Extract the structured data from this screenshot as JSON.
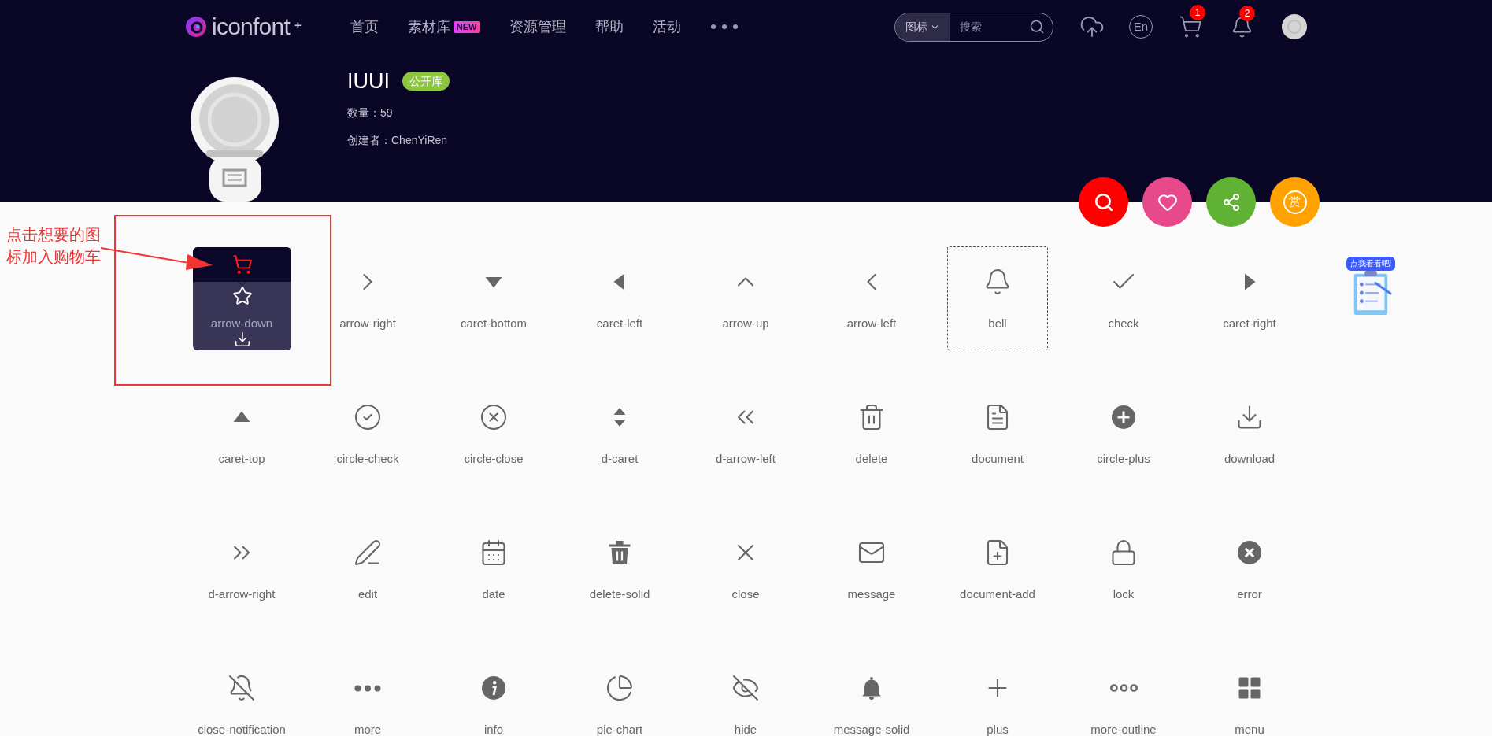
{
  "nav": {
    "logo": "iconfont",
    "logo_mark": "+",
    "items": [
      {
        "label": "首页"
      },
      {
        "label": "素材库",
        "badge": "NEW"
      },
      {
        "label": "资源管理"
      },
      {
        "label": "帮助"
      },
      {
        "label": "活动"
      }
    ]
  },
  "search": {
    "scope": "图标",
    "placeholder": "搜索"
  },
  "toolbar": {
    "language": "En",
    "cart_count": "1",
    "notification_count": "2"
  },
  "library": {
    "title": "IUUI",
    "tag": "公开库",
    "count": "数量：59",
    "creator": "创建者：ChenYiRen"
  },
  "actions": [
    {
      "kind": "search",
      "color": "#ff0000"
    },
    {
      "kind": "favorite",
      "color": "#e8498b"
    },
    {
      "kind": "share",
      "color": "#5fb233"
    },
    {
      "kind": "reward",
      "color": "#ffa200",
      "label": "赏"
    }
  ],
  "annotation": "点击想要的图标加入购物车",
  "promo": "点我看看吧!",
  "icons": [
    {
      "label": "arrow-down",
      "selected": false,
      "hovered": true
    },
    {
      "label": "arrow-right",
      "selected": false,
      "hovered": false
    },
    {
      "label": "caret-bottom",
      "selected": false,
      "hovered": false
    },
    {
      "label": "caret-left",
      "selected": false,
      "hovered": false
    },
    {
      "label": "arrow-up",
      "selected": false,
      "hovered": false
    },
    {
      "label": "arrow-left",
      "selected": false,
      "hovered": false
    },
    {
      "label": "bell",
      "selected": true,
      "hovered": false
    },
    {
      "label": "check",
      "selected": false,
      "hovered": false
    },
    {
      "label": "caret-right",
      "selected": false,
      "hovered": false
    },
    {
      "label": "caret-top",
      "selected": false,
      "hovered": false
    },
    {
      "label": "circle-check",
      "selected": false,
      "hovered": false
    },
    {
      "label": "circle-close",
      "selected": false,
      "hovered": false
    },
    {
      "label": "d-caret",
      "selected": false,
      "hovered": false
    },
    {
      "label": "d-arrow-left",
      "selected": false,
      "hovered": false
    },
    {
      "label": "delete",
      "selected": false,
      "hovered": false
    },
    {
      "label": "document",
      "selected": false,
      "hovered": false
    },
    {
      "label": "circle-plus",
      "selected": false,
      "hovered": false
    },
    {
      "label": "download",
      "selected": false,
      "hovered": false
    },
    {
      "label": "d-arrow-right",
      "selected": false,
      "hovered": false
    },
    {
      "label": "edit",
      "selected": false,
      "hovered": false
    },
    {
      "label": "date",
      "selected": false,
      "hovered": false
    },
    {
      "label": "delete-solid",
      "selected": false,
      "hovered": false
    },
    {
      "label": "close",
      "selected": false,
      "hovered": false
    },
    {
      "label": "message",
      "selected": false,
      "hovered": false
    },
    {
      "label": "document-add",
      "selected": false,
      "hovered": false
    },
    {
      "label": "lock",
      "selected": false,
      "hovered": false
    },
    {
      "label": "error",
      "selected": false,
      "hovered": false
    },
    {
      "label": "close-notification",
      "selected": false,
      "hovered": false
    },
    {
      "label": "more",
      "selected": false,
      "hovered": false
    },
    {
      "label": "info",
      "selected": false,
      "hovered": false
    },
    {
      "label": "pie-chart",
      "selected": false,
      "hovered": false
    },
    {
      "label": "hide",
      "selected": false,
      "hovered": false
    },
    {
      "label": "message-solid",
      "selected": false,
      "hovered": false
    },
    {
      "label": "plus",
      "selected": false,
      "hovered": false
    },
    {
      "label": "more-outline",
      "selected": false,
      "hovered": false
    },
    {
      "label": "menu",
      "selected": false,
      "hovered": false
    }
  ]
}
